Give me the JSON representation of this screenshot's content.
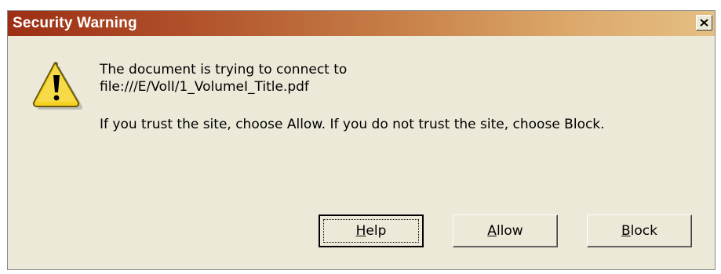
{
  "window": {
    "title": "Security Warning",
    "close_label": "×"
  },
  "message": {
    "line1": "The document is trying to connect to",
    "line2": "file:///E/VolI/1_VolumeI_Title.pdf",
    "line3": "If you trust the site, choose Allow. If you do not trust the site, choose Block."
  },
  "buttons": {
    "help": {
      "mnemonic": "H",
      "rest": "elp"
    },
    "allow": {
      "mnemonic": "A",
      "rest": "llow"
    },
    "block": {
      "mnemonic": "B",
      "rest": "lock"
    }
  },
  "icons": {
    "warning": "warning-triangle-icon",
    "close": "close-icon"
  },
  "colors": {
    "dialog_bg": "#ece9d8",
    "title_start": "#9c2e14",
    "title_end": "#e5bf83",
    "warning_yellow": "#f4d21f"
  }
}
